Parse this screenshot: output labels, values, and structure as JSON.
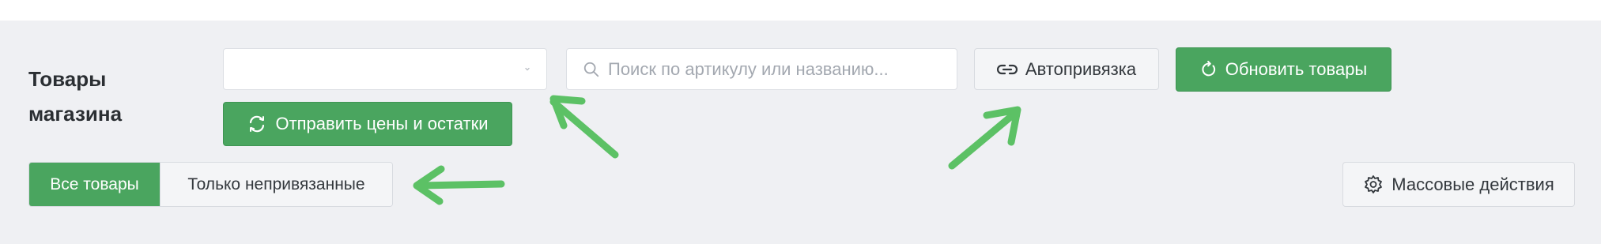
{
  "header": {
    "title": "Товары магазина"
  },
  "filters": {
    "store_select_value": "",
    "search_placeholder": "Поиск по артикулу или названию..."
  },
  "actions": {
    "autobind_label": "Автопривязка",
    "refresh_label": "Обновить товары",
    "send_prices_label": "Отправить цены и остатки",
    "bulk_actions_label": "Массовые действия"
  },
  "tabs": [
    {
      "label": "Все товары",
      "active": true
    },
    {
      "label": "Только непривязанные",
      "active": false
    }
  ],
  "colors": {
    "primary_green": "#4aa55f",
    "annotation_arrow": "#5cc165",
    "panel_background": "#eff0f3"
  },
  "icons": {
    "store_select": "chevron-down-icon",
    "search": "search-icon",
    "autobind": "link-icon",
    "refresh": "refresh-icon",
    "send_prices": "sync-icon",
    "bulk_actions": "gear-icon"
  }
}
